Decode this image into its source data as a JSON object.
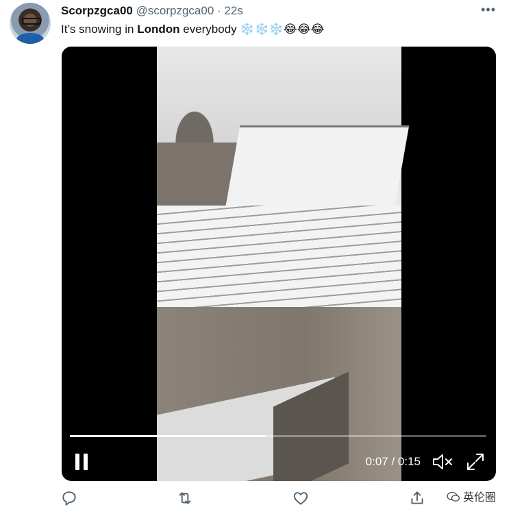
{
  "tweet": {
    "display_name": "Scorpzgca00",
    "handle": "@scorpzgca00",
    "separator": "·",
    "time": "22s",
    "text_before": "It’s snowing in ",
    "text_bold": "London",
    "text_after": " everybody ",
    "emojis": [
      "❄️",
      "❄️",
      "❄️",
      "😂",
      "😂",
      "😂"
    ]
  },
  "more_label": "•••",
  "video": {
    "elapsed": "0:07",
    "duration": "0:15",
    "time_sep": " / ",
    "progress": 0.47,
    "state_icon": "pause-icon",
    "muted": true
  },
  "actions": [
    "reply-icon",
    "retweet-icon",
    "like-icon",
    "share-icon"
  ],
  "watermark": "英伦圈",
  "colors": {
    "text": "#0f1419",
    "muted": "#536471",
    "video_bg": "#000000"
  }
}
